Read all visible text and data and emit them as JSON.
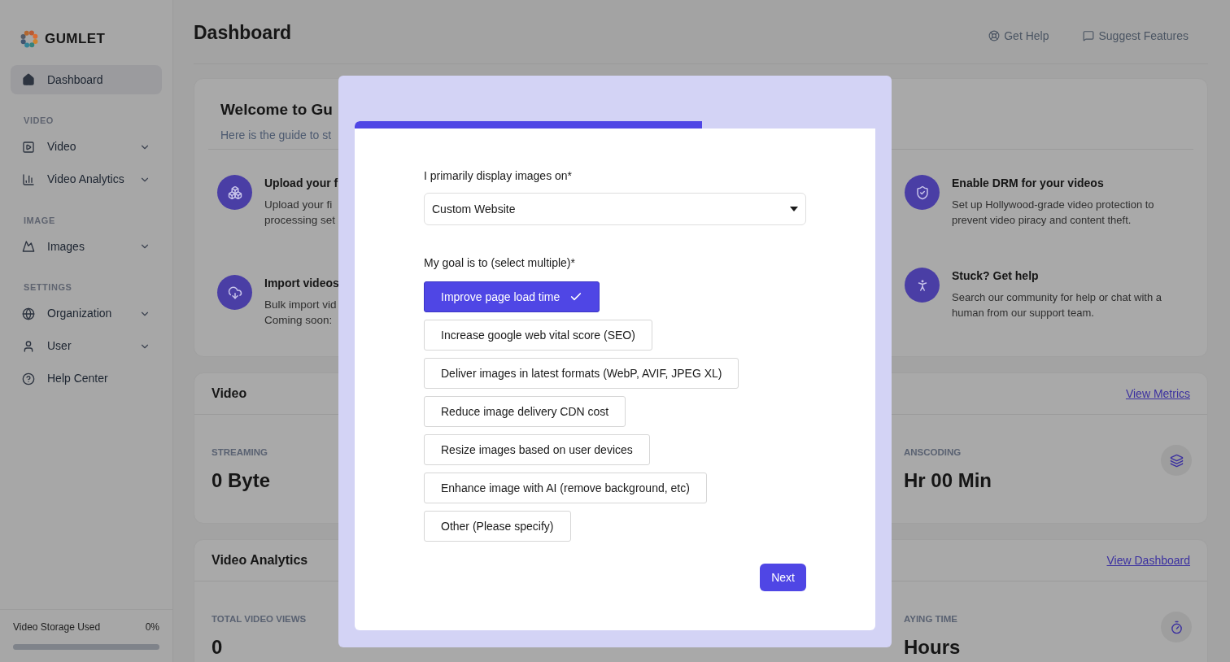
{
  "sidebar": {
    "brand": "GUMLET",
    "groups": [
      {
        "items": [
          {
            "label": "Dashboard",
            "selected": true,
            "expandable": false
          }
        ]
      },
      {
        "heading": "VIDEO",
        "items": [
          {
            "label": "Video",
            "selected": false,
            "expandable": true
          },
          {
            "label": "Video Analytics",
            "selected": false,
            "expandable": true
          }
        ]
      },
      {
        "heading": "IMAGE",
        "items": [
          {
            "label": "Images",
            "selected": false,
            "expandable": true
          }
        ]
      },
      {
        "heading": "SETTINGS",
        "items": [
          {
            "label": "Organization",
            "selected": false,
            "expandable": true
          },
          {
            "label": "User",
            "selected": false,
            "expandable": true
          },
          {
            "label": "Help Center",
            "selected": false,
            "expandable": false
          }
        ]
      }
    ],
    "storage": {
      "label": "Video Storage Used",
      "value": "0%"
    }
  },
  "header": {
    "title": "Dashboard",
    "actions": [
      "Get Help",
      "Suggest Features"
    ]
  },
  "welcome": {
    "title": "Welcome to Gu",
    "subtitle": "Here is the guide to st",
    "left_items": [
      {
        "title": "Upload your f",
        "lines": [
          "Upload your fi",
          "processing set"
        ]
      },
      {
        "title": "Import videos",
        "lines": [
          "Bulk import vid",
          "Coming soon:"
        ]
      }
    ],
    "right_items": [
      {
        "title": "Enable DRM for your videos",
        "description": "Set up Hollywood-grade video protection to prevent video piracy and content theft."
      },
      {
        "title": "Stuck? Get help",
        "description": "Search our community for help or chat with a human from our support team."
      }
    ]
  },
  "cards": [
    {
      "title": "Video",
      "link": "View Metrics",
      "left_stat": {
        "label": "STREAMING",
        "value": "0 Byte"
      },
      "right_stat": {
        "label": "ANSCODING",
        "value": "Hr 00 Min"
      }
    },
    {
      "title": "Video Analytics",
      "link": "View Dashboard",
      "left_stat": {
        "label": "TOTAL VIDEO VIEWS",
        "value": "0"
      },
      "right_stat": {
        "label": "AYING TIME",
        "value": "Hours"
      }
    }
  ],
  "modal": {
    "progress": {
      "level": 0.667
    },
    "question_1": {
      "label": "I primarily display images on*",
      "value": "Custom Website"
    },
    "question_2": {
      "label": "My goal is to (select multiple)*",
      "options": [
        {
          "label": "Improve page load time",
          "selected": true
        },
        {
          "label": "Increase google web vital score (SEO)",
          "selected": false
        },
        {
          "label": "Deliver images in latest formats (WebP, AVIF, JPEG XL)",
          "selected": false
        },
        {
          "label": "Reduce image delivery CDN cost",
          "selected": false
        },
        {
          "label": "Resize images based on user devices",
          "selected": false
        },
        {
          "label": "Enhance image with AI (remove background, etc)",
          "selected": false
        },
        {
          "label": "Other (Please specify)",
          "selected": false
        }
      ]
    },
    "next_button": "Next"
  }
}
